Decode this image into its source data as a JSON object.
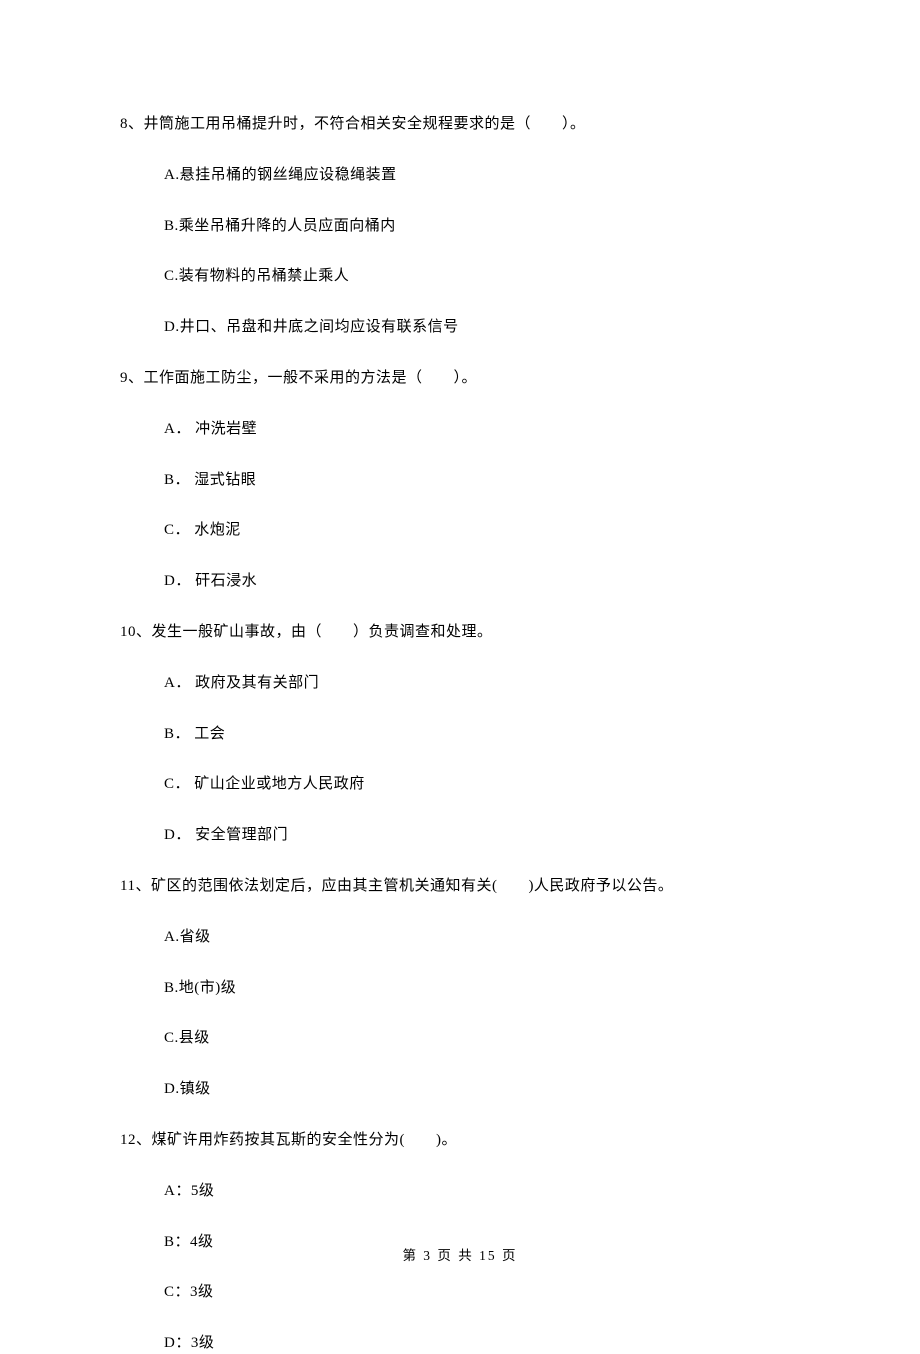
{
  "questions": [
    {
      "stem": "8、井筒施工用吊桶提升时，不符合相关安全规程要求的是（　　）。",
      "options": [
        "A.悬挂吊桶的钢丝绳应设稳绳装置",
        "B.乘坐吊桶升降的人员应面向桶内",
        "C.装有物料的吊桶禁止乘人",
        "D.井口、吊盘和井底之间均应设有联系信号"
      ]
    },
    {
      "stem": "9、工作面施工防尘，一般不采用的方法是（　　）。",
      "options": [
        "A． 冲洗岩壁",
        "B． 湿式钻眼",
        "C． 水炮泥",
        "D． 矸石浸水"
      ]
    },
    {
      "stem": "10、发生一般矿山事故，由（　　）负责调查和处理。",
      "options": [
        "A． 政府及其有关部门",
        "B． 工会",
        "C． 矿山企业或地方人民政府",
        "D． 安全管理部门"
      ]
    },
    {
      "stem": "11、矿区的范围依法划定后，应由其主管机关通知有关(　　)人民政府予以公告。",
      "options": [
        "A.省级",
        "B.地(市)级",
        "C.县级",
        "D.镇级"
      ]
    },
    {
      "stem": "12、煤矿许用炸药按其瓦斯的安全性分为(　　)。",
      "options": [
        "A：5级",
        "B：4级",
        "C：3级",
        "D：3级"
      ]
    }
  ],
  "footer": "第 3 页 共 15 页"
}
